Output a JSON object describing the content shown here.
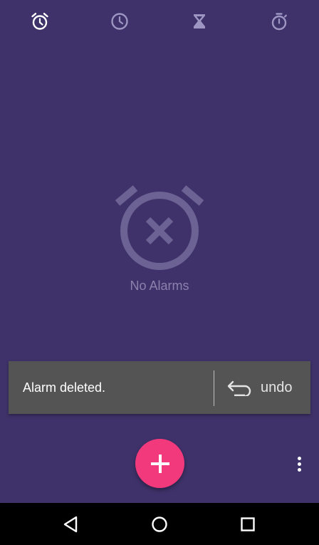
{
  "tabs": [
    {
      "name": "alarm",
      "icon": "alarm-clock-icon",
      "selected": true
    },
    {
      "name": "clock",
      "icon": "clock-icon",
      "selected": false
    },
    {
      "name": "timer",
      "icon": "hourglass-icon",
      "selected": false
    },
    {
      "name": "stopwatch",
      "icon": "stopwatch-icon",
      "selected": false
    }
  ],
  "empty_state": {
    "icon": "alarm-off-icon",
    "label": "No Alarms"
  },
  "snackbar": {
    "message": "Alarm deleted.",
    "action_label": "undo",
    "action_icon": "undo-icon"
  },
  "fab": {
    "icon": "plus-icon",
    "color": "#f2397c"
  },
  "overflow_menu": {
    "icon": "more-vertical-icon"
  },
  "navigation_bar": {
    "buttons": [
      "back-icon",
      "home-icon",
      "recents-icon"
    ]
  },
  "colors": {
    "background": "#3f326a",
    "snackbar": "#545454",
    "accent": "#f2397c",
    "muted_text": "#8a81ad"
  }
}
